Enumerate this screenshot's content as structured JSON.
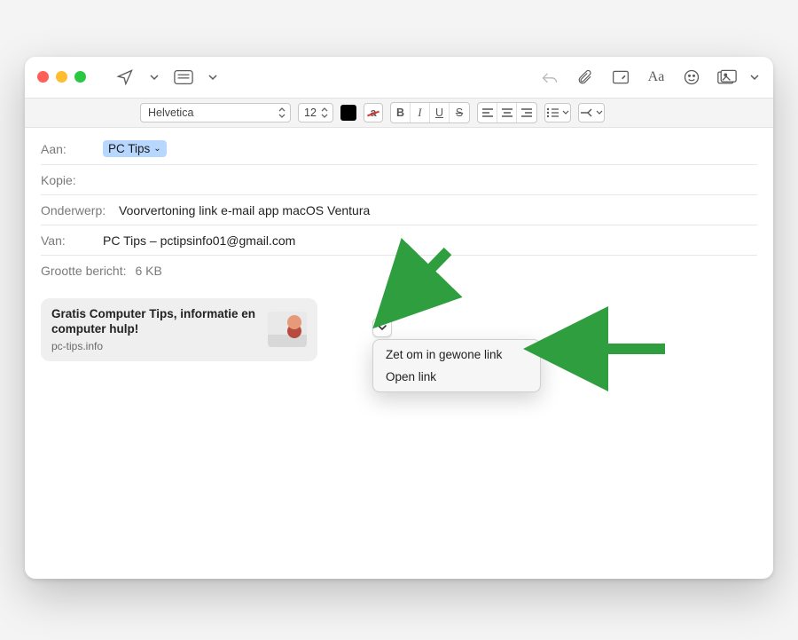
{
  "format_bar": {
    "font": "Helvetica",
    "size": "12",
    "bold": "B",
    "italic": "I",
    "underline": "U",
    "strike": "S"
  },
  "fields": {
    "to_label": "Aan:",
    "to_recipient": "PC Tips",
    "cc_label": "Kopie:",
    "subject_label": "Onderwerp:",
    "subject_value": "Voorvertoning link e-mail app macOS Ventura",
    "from_label": "Van:",
    "from_value": "PC Tips – pctipsinfo01@gmail.com",
    "size_label": "Grootte bericht:",
    "size_value": "6 KB"
  },
  "link_card": {
    "title": "Gratis Computer Tips, informatie en computer hulp!",
    "subtitle": "pc-tips.info"
  },
  "context_menu": {
    "items": [
      "Zet om in gewone link",
      "Open link"
    ]
  }
}
